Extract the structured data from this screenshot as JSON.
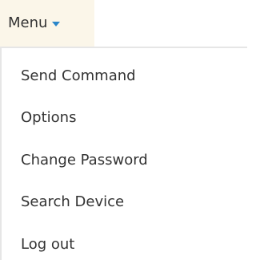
{
  "menu": {
    "label": "Menu",
    "caret_color": "#2a86c9",
    "button_bg": "#fbf6e9"
  },
  "items": [
    {
      "label": "Send Command"
    },
    {
      "label": "Options"
    },
    {
      "label": "Change Password"
    },
    {
      "label": "Search Device"
    },
    {
      "label": "Log out"
    }
  ]
}
